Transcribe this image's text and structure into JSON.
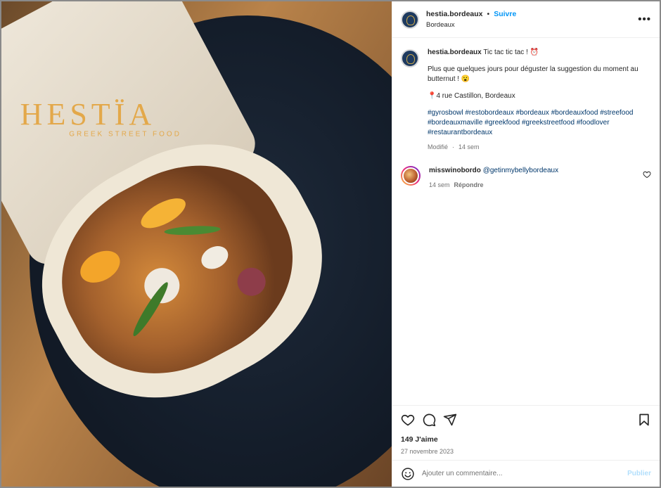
{
  "post": {
    "username": "hestia.bordeaux",
    "separator": "•",
    "follow_label": "Suivre",
    "location": "Bordeaux",
    "more_label": "•••",
    "photo_logo": "HESTÏA",
    "photo_subtitle": "GREEK STREET FOOD"
  },
  "caption": {
    "username": "hestia.bordeaux",
    "line1": "Tic tac tic tac ! ⏰",
    "line2": "Plus que quelques jours pour déguster la suggestion du moment au butternut ! 😮",
    "line3": "📍4 rue Castillon, Bordeaux",
    "hashtags": [
      "#gyrosbowl",
      "#restobordeaux",
      "#bordeaux",
      "#bordeauxfood",
      "#streefood",
      "#bordeauxmaville",
      "#greekfood",
      "#greekstreetfood",
      "#foodlover",
      "#restaurantbordeaux"
    ],
    "meta_edited": "Modifié",
    "meta_sep": "·",
    "meta_time": "14 sem"
  },
  "comment": {
    "username": "misswinobordo",
    "text": "@getinmybellybordeaux",
    "time": "14 sem",
    "reply_label": "Répondre"
  },
  "actions": {
    "likes": "149 J'aime",
    "date": "27 novembre 2023"
  },
  "add_comment": {
    "placeholder": "Ajouter un commentaire...",
    "publish_label": "Publier"
  },
  "colors": {
    "link": "#0095f6",
    "hashtag": "#00376b",
    "muted": "#737373"
  }
}
